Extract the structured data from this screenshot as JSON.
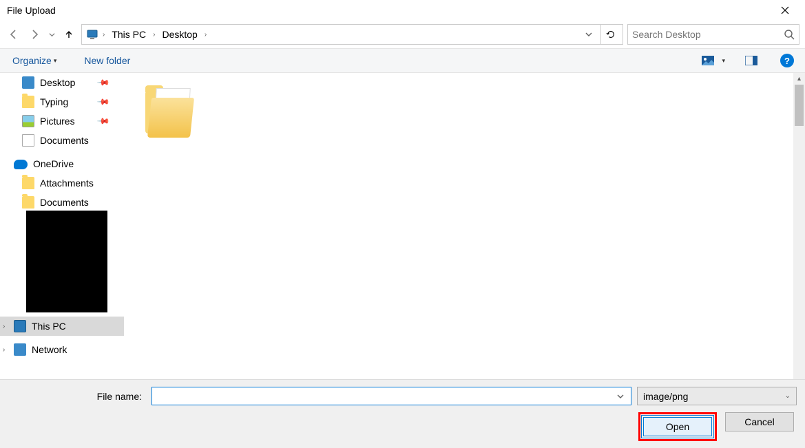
{
  "title": "File Upload",
  "breadcrumb": {
    "items": [
      "This PC",
      "Desktop"
    ]
  },
  "search": {
    "placeholder": "Search Desktop"
  },
  "toolbar": {
    "organize": "Organize",
    "newfolder": "New folder"
  },
  "sidebar": {
    "quick": [
      {
        "label": "Desktop",
        "pinned": true,
        "icon": "desktop"
      },
      {
        "label": "Typing",
        "pinned": true,
        "icon": "folder"
      },
      {
        "label": "Pictures",
        "pinned": true,
        "icon": "pictures"
      },
      {
        "label": "Documents",
        "pinned": false,
        "icon": "documents"
      }
    ],
    "onedrive": {
      "label": "OneDrive",
      "children": [
        {
          "label": "Attachments"
        },
        {
          "label": "Documents"
        }
      ]
    },
    "thispc": {
      "label": "This PC"
    },
    "network": {
      "label": "Network"
    }
  },
  "content": {
    "items": [
      {
        "type": "folder",
        "name": ""
      }
    ]
  },
  "bottom": {
    "filename_label": "File name:",
    "filename_value": "",
    "filter": "image/png",
    "open": "Open",
    "cancel": "Cancel"
  }
}
